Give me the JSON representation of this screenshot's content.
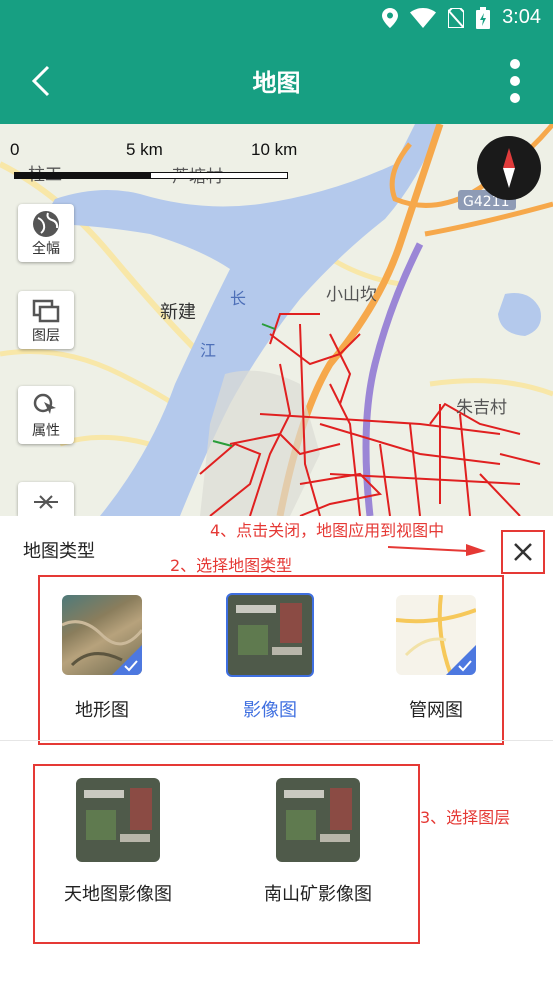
{
  "status_bar": {
    "time": "3:04",
    "icons": [
      "location-icon",
      "wifi-icon",
      "no-sim-icon",
      "battery-charging-icon"
    ]
  },
  "header": {
    "title": "地图",
    "back_icon": "back-arrow-icon",
    "more_icon": "more-vertical-icon"
  },
  "map": {
    "scale_labels": [
      "0",
      "5 km",
      "10 km"
    ],
    "place_labels": [
      "芦塘村",
      "新建",
      "小山坎",
      "朱吉村",
      "长",
      "江",
      "G4211",
      "柱工"
    ],
    "tools": [
      {
        "label": "全幅",
        "icon": "globe-icon"
      },
      {
        "label": "图层",
        "icon": "layers-icon"
      },
      {
        "label": "属性",
        "icon": "inspect-icon"
      }
    ]
  },
  "panel": {
    "title": "地图类型",
    "close_icon": "close-icon",
    "map_types": [
      {
        "label": "地形图",
        "checked": true,
        "selected": false
      },
      {
        "label": "影像图",
        "checked": false,
        "selected": true
      },
      {
        "label": "管网图",
        "checked": true,
        "selected": false
      }
    ],
    "layers": [
      {
        "label": "天地图影像图"
      },
      {
        "label": "南山矿影像图"
      }
    ]
  },
  "annotations": {
    "step2": "2、选择地图类型",
    "step3": "3、选择图层",
    "step4": "4、点击关闭，地图应用到视图中"
  },
  "colors": {
    "primary": "#179f82",
    "annotation": "#e53935",
    "selected_text": "#3f6fe0"
  }
}
